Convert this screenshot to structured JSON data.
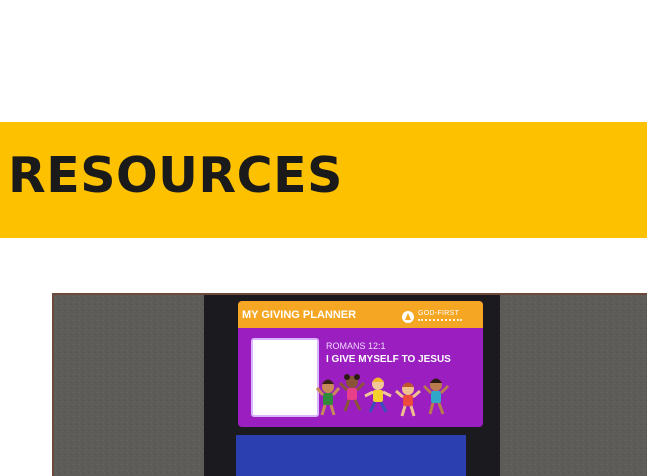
{
  "section": {
    "title": "RESOURCES"
  },
  "colors": {
    "banner": "#FDC100",
    "card": "#9b1ec1",
    "card_header": "#F5A623",
    "folder_blue": "#2b3fb0"
  },
  "planner_card": {
    "title": "MY GIVING PLANNER",
    "brand": "GOD-FIRST",
    "verse_reference": "ROMANS 12:1",
    "verse_text": "I GIVE MYSELF TO JESUS",
    "illustration": "children-jumping",
    "logo_icon": "god-first-logo-icon"
  }
}
